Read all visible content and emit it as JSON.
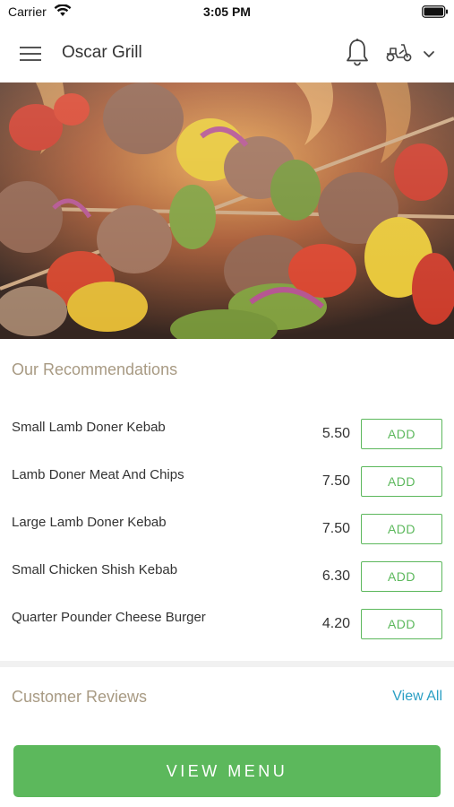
{
  "status_bar": {
    "carrier": "Carrier",
    "time": "3:05 PM"
  },
  "header": {
    "title": "Oscar Grill"
  },
  "recommendations": {
    "title": "Our Recommendations",
    "add_label": "ADD",
    "items": [
      {
        "name": "Small Lamb Doner Kebab",
        "price": "5.50"
      },
      {
        "name": "Lamb Doner Meat And Chips",
        "price": "7.50"
      },
      {
        "name": "Large Lamb Doner Kebab",
        "price": "7.50"
      },
      {
        "name": "Small Chicken Shish Kebab",
        "price": "6.30"
      },
      {
        "name": "Quarter Pounder Cheese Burger",
        "price": "4.20"
      }
    ]
  },
  "reviews": {
    "title": "Customer Reviews",
    "view_all": "View All"
  },
  "view_menu_label": "VIEW MENU",
  "colors": {
    "accent": "#5cb85c",
    "heading": "#a89a83",
    "link": "#2a9fc4"
  }
}
